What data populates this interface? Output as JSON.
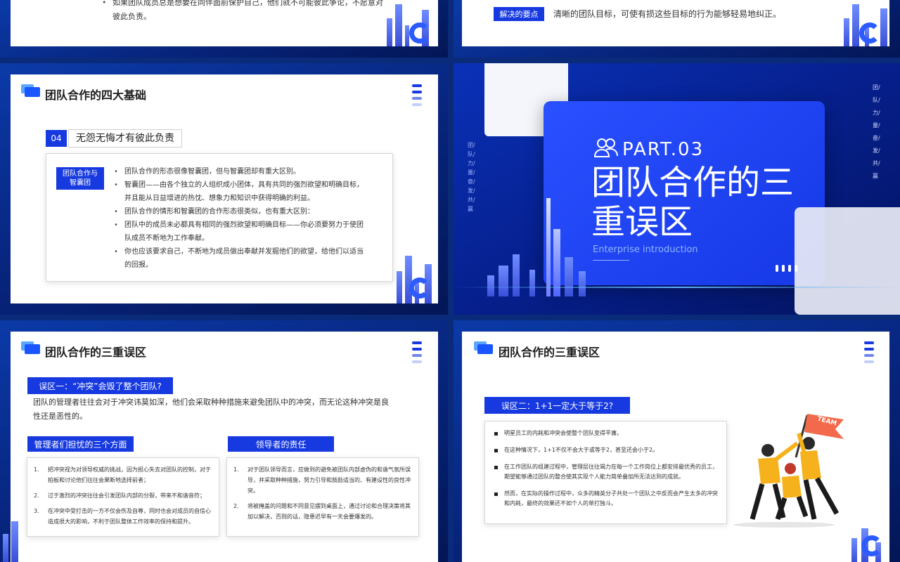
{
  "slides": {
    "top_left": {
      "bullet": "如果团队成员总是想要在同伴面前保护自己，他们就不可能彼此争论，不愿意对彼此负责。"
    },
    "top_right": {
      "tag": "解决的要点",
      "text": "清晰的团队目标，可使有损这些目标的行为能够轻易地纠正。"
    },
    "mid_left": {
      "title": "团队合作的四大基础",
      "num": "04",
      "heading": "无怨无悔才有彼此负责",
      "side_tag": "团队合作与智囊团",
      "bullets": [
        "团队合作的形态很像智囊团，但与智囊团却有重大区别。",
        "智囊团——由各个独立的人组织成小团体，具有共同的强烈欲望和明确目标，并且能从日益增进的热忱、想象力和知识中获得明确的利益。",
        "团队合作的情形和智囊团的合作形态很类似，也有重大区别：",
        "团队中的成员未必都具有相同的强烈欲望和明确目标——你必须要努力于使团队成员不断地为工作奉献。",
        "你也应该要求自己，不断地为成员做出奉献并发掘他们的欲望，给他们以适当的回报。"
      ]
    },
    "mid_right": {
      "part": "PART.03",
      "title_line1": "团队合作的三",
      "title_line2": "重误区",
      "subtitle": "Enterprise introduction",
      "vertical_text": "团/队/力/量/奋/发/共/赢",
      "vertical_text_right": "团/队/力/量/奋/发/共/赢"
    },
    "bottom_left": {
      "title": "团队合作的三重误区",
      "myth_tag": "误区一：“冲突”会毁了整个团队?",
      "myth_text": "团队的管理者往往会对于冲突讳莫如深，他们会采取种种措施来避免团队中的冲突，而无论这种冲突是良性还是恶性的。",
      "left_tag": "管理者们担忧的三个方面",
      "left_items": [
        {
          "n": "1.",
          "text": "把冲突视为对领导权威的挑战，因为担心失去对团队的控制，对于拍板和讨论他们往往会果断地选择前者；"
        },
        {
          "n": "2.",
          "text": "过于激烈的冲突往往会引发团队内部的分裂，带来不和谐音符；"
        },
        {
          "n": "3.",
          "text": "在冲突中受打击的一方不仅会伤及自尊，同时也会对成员的自信心造成很大的影响，不利于团队整体工作效率的保持和提升。"
        }
      ],
      "right_tag": "领导者的责任",
      "right_items": [
        {
          "n": "1.",
          "text": "对于团队领导而言，应做到的避免被团队内部虚伪的和谐气氛所误导，并采取种种措施，努力引导和鼓励适当的、有建设性的良性冲突。"
        },
        {
          "n": "2.",
          "text": "将被掩盖的问题和不同意见摆到桌面上，通过讨论和合理决策将其加以解决，否则的话，隐患迟早有一天会要爆发的。"
        }
      ]
    },
    "bottom_right": {
      "title": "团队合作的三重误区",
      "myth_tag": "误区二：1+1一定大于等于2?",
      "items": [
        "明星员工的内耗和冲突会使整个团队变得平庸。",
        "在这种情况下，1+1不仅不会大于或等于2，甚至还会小于2。",
        "在工作团队的组建过程中，管理层往往竭力在每一个工作岗位上都安排最优秀的员工，期望能够通过团队的整合使其实现个人能力简单叠加所无法达到的成就。",
        "然而，在实际的操作过程中，众多的精英分子共处一个团队之中反而会产生太多的冲突和内耗，最终的效果还不如个人的单打独斗。"
      ],
      "flag_text": "TEAM"
    }
  },
  "colors": {
    "accent": "#1639e0",
    "bg_dark": "#07237a",
    "people_yellow": "#f6b21c",
    "flag": "#f26a4b"
  }
}
